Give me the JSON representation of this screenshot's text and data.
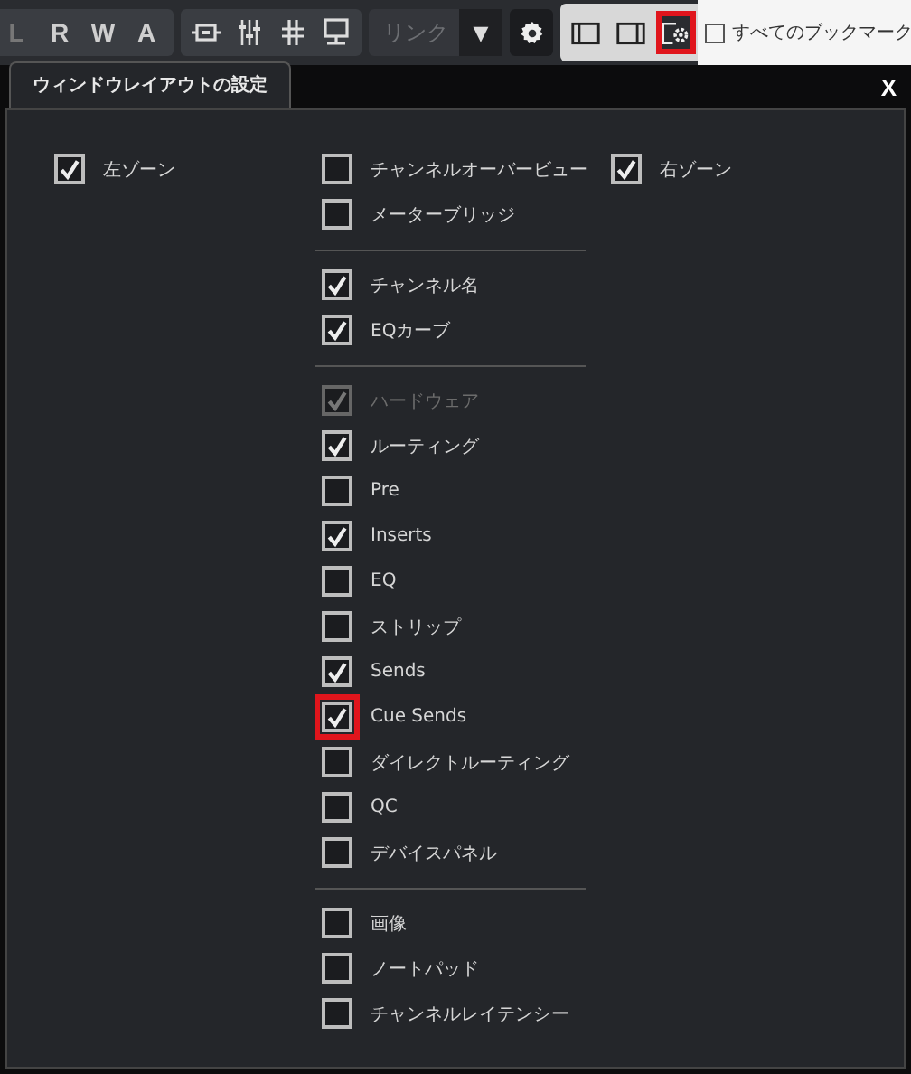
{
  "toolbar": {
    "automation_buttons": [
      "L",
      "R",
      "W",
      "A"
    ],
    "link_dropdown": {
      "value": "リンク",
      "arrow": "▼",
      "disabled": true
    },
    "zone_toggles": [
      {
        "kind": "left",
        "highlighted": false
      },
      {
        "kind": "right",
        "highlighted": false
      },
      {
        "kind": "settings",
        "highlighted": true
      }
    ],
    "bookmarks": {
      "label": "すべてのブックマーク",
      "checked": false
    }
  },
  "dialog": {
    "tab": "ウィンドウレイアウトの設定",
    "close": "X",
    "left": [
      {
        "label": "左ゾーン",
        "checked": true,
        "disabled": false,
        "highlighted": false
      }
    ],
    "groups": [
      [
        {
          "label": "チャンネルオーバービュー",
          "checked": false,
          "disabled": false,
          "highlighted": false
        },
        {
          "label": "メーターブリッジ",
          "checked": false,
          "disabled": false,
          "highlighted": false
        }
      ],
      [
        {
          "label": "チャンネル名",
          "checked": true,
          "disabled": false,
          "highlighted": false
        },
        {
          "label": "EQカーブ",
          "checked": true,
          "disabled": false,
          "highlighted": false
        }
      ],
      [
        {
          "label": "ハードウェア",
          "checked": true,
          "disabled": true,
          "highlighted": false
        },
        {
          "label": "ルーティング",
          "checked": true,
          "disabled": false,
          "highlighted": false
        },
        {
          "label": "Pre",
          "checked": false,
          "disabled": false,
          "highlighted": false
        },
        {
          "label": "Inserts",
          "checked": true,
          "disabled": false,
          "highlighted": false
        },
        {
          "label": "EQ",
          "checked": false,
          "disabled": false,
          "highlighted": false
        },
        {
          "label": "ストリップ",
          "checked": false,
          "disabled": false,
          "highlighted": false
        },
        {
          "label": "Sends",
          "checked": true,
          "disabled": false,
          "highlighted": false
        },
        {
          "label": "Cue Sends",
          "checked": true,
          "disabled": false,
          "highlighted": true
        },
        {
          "label": "ダイレクトルーティング",
          "checked": false,
          "disabled": false,
          "highlighted": false
        },
        {
          "label": "QC",
          "checked": false,
          "disabled": false,
          "highlighted": false
        },
        {
          "label": "デバイスパネル",
          "checked": false,
          "disabled": false,
          "highlighted": false
        }
      ],
      [
        {
          "label": "画像",
          "checked": false,
          "disabled": false,
          "highlighted": false
        },
        {
          "label": "ノートパッド",
          "checked": false,
          "disabled": false,
          "highlighted": false
        },
        {
          "label": "チャンネルレイテンシー",
          "checked": false,
          "disabled": false,
          "highlighted": false
        }
      ]
    ],
    "right": [
      {
        "label": "右ゾーン",
        "checked": true,
        "disabled": false,
        "highlighted": false
      }
    ]
  }
}
